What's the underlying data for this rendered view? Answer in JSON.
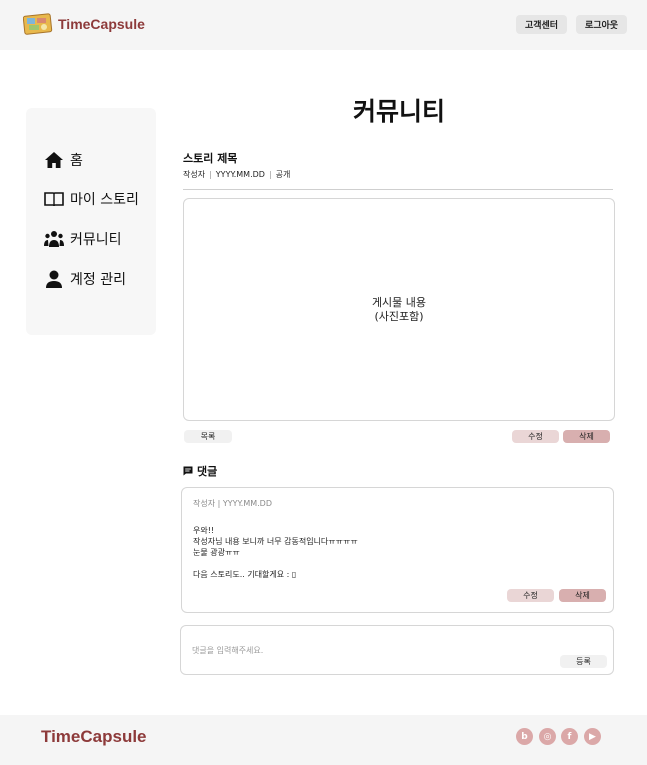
{
  "header": {
    "brand": "TimeCapsule",
    "support_label": "고객센터",
    "logout_label": "로그아웃"
  },
  "sidebar": {
    "items": [
      {
        "label": "홈",
        "icon": "home-icon"
      },
      {
        "label": "마이 스토리",
        "icon": "book-icon"
      },
      {
        "label": "커뮤니티",
        "icon": "community-icon"
      },
      {
        "label": "계정 관리",
        "icon": "user-icon"
      }
    ]
  },
  "main": {
    "page_title": "커뮤니티",
    "story_title": "스토리 제목",
    "meta": {
      "author": "작성자",
      "date": "YYYY.MM.DD",
      "visibility": "공개"
    },
    "content_line1": "게시물 내용",
    "content_line2": "(사진포함)",
    "list_label": "목록",
    "edit_label": "수정",
    "delete_label": "삭제"
  },
  "comments": {
    "heading": "댓글",
    "items": [
      {
        "meta": "작성자 | YYYY.MM.DD",
        "body": "우와!!\n작성자님 내용 보니까 너무 감동적입니다ㅠㅠㅠㅠ\n눈물 광광ㅠㅠ\n\n다음 스토리도.. 기대할게요 : ▯",
        "edit_label": "수정",
        "delete_label": "삭제"
      }
    ],
    "input_placeholder": "댓글을 입력해주세요.",
    "submit_label": "등록"
  },
  "footer": {
    "brand": "TimeCapsule",
    "social": [
      {
        "name": "blog-icon",
        "glyph": "b"
      },
      {
        "name": "instagram-icon",
        "glyph": "◎"
      },
      {
        "name": "facebook-icon",
        "glyph": "f"
      },
      {
        "name": "youtube-icon",
        "glyph": "▶"
      }
    ]
  },
  "colors": {
    "brand": "#8d3a3a",
    "edit_button": "#ead6d6",
    "delete_button": "#d8afaf",
    "social_icon": "#dba8a8",
    "header_bg": "#f5f5f5"
  }
}
